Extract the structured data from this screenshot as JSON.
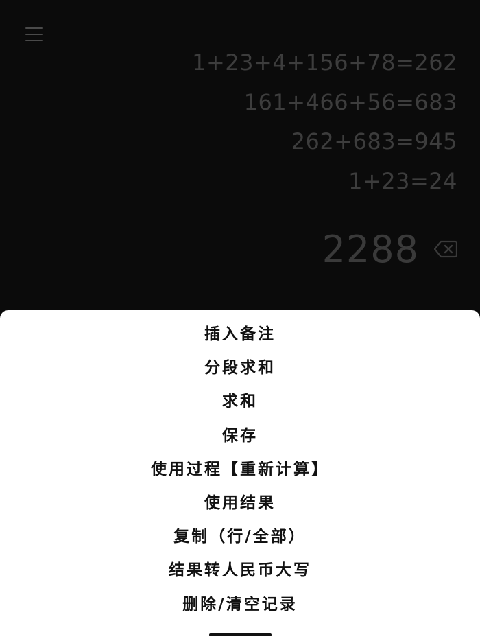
{
  "history": [
    "1+23+4+156+78=262",
    "161+466+56=683",
    "262+683=945",
    "1+23=24"
  ],
  "result": "2288",
  "menu": {
    "items": [
      "插入备注",
      "分段求和",
      "求和",
      "保存",
      "使用过程【重新计算】",
      "使用结果",
      "复制（行/全部）",
      "结果转人民币大写",
      "删除/清空记录"
    ]
  },
  "icons": {
    "menu": "hamburger-menu-icon",
    "backspace": "backspace-icon"
  },
  "colors": {
    "background": "#0b0b0b",
    "history_text": "#3d3d3d",
    "result_text": "#3a3a3a",
    "sheet_background": "#ffffff",
    "sheet_text": "#111111"
  }
}
